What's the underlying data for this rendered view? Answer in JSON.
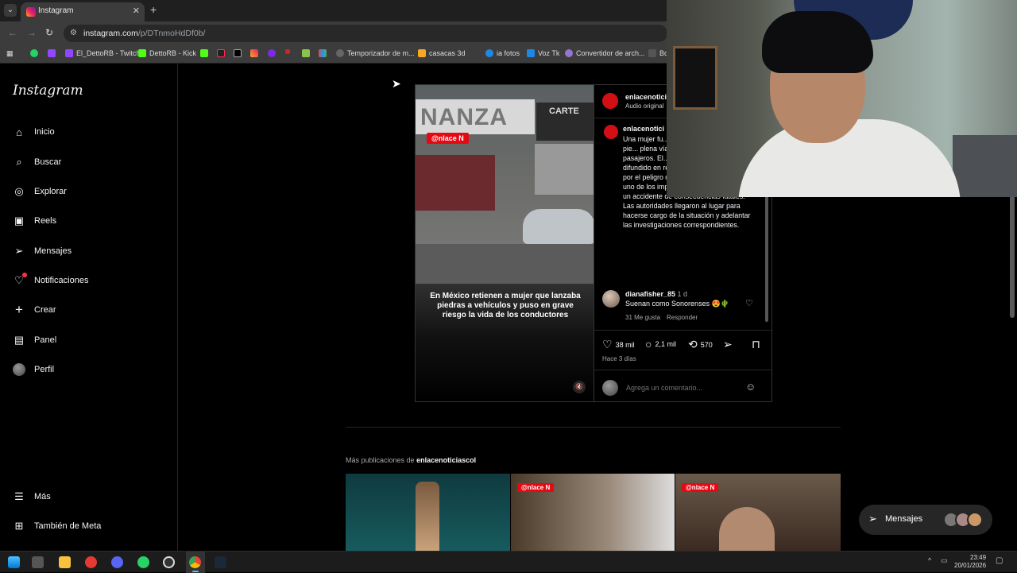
{
  "browser": {
    "tab_title": "Instagram",
    "tab_close": "✕",
    "new_tab": "+",
    "url_host": "instagram.com",
    "url_path": "/p/DTnmoHdDf0b/",
    "bookmarks": [
      "El_DettoRB - Twitch",
      "DettoRB - Kick",
      "Temporizador de m...",
      "casacas 3d",
      "ia fotos",
      "Voz Tk",
      "Convertidor de arch...",
      "Bot"
    ]
  },
  "sidebar": {
    "logo": "Instagram",
    "items": [
      {
        "label": "Inicio",
        "icon": "home-icon"
      },
      {
        "label": "Buscar",
        "icon": "search-icon"
      },
      {
        "label": "Explorar",
        "icon": "compass-icon"
      },
      {
        "label": "Reels",
        "icon": "reels-icon"
      },
      {
        "label": "Mensajes",
        "icon": "send-icon"
      },
      {
        "label": "Notificaciones",
        "icon": "heart-icon"
      },
      {
        "label": "Crear",
        "icon": "plus-icon"
      },
      {
        "label": "Panel",
        "icon": "dashboard-icon"
      },
      {
        "label": "Perfil",
        "icon": "avatar"
      }
    ],
    "bottom": [
      {
        "label": "Más",
        "icon": "menu-icon"
      },
      {
        "label": "También de Meta",
        "icon": "meta-icon"
      }
    ]
  },
  "post": {
    "video_badge": "@nlace N",
    "video_sign": "NANZA",
    "video_billboard": "CARTE",
    "video_caption": "En México retienen a mujer que lanzaba piedras a vehículos y puso en grave riesgo la vida de los conductores",
    "author": "enlacenotici",
    "audio": "Audio original",
    "caption_author": "enlacenotici",
    "caption": "Una mujer fu... en México lu... lanzando pie... plena vía, una... riesgo la vida... pasajeros. El... registrado en video y difundido en redes sociales, generó alarma por el peligro que representaba, ya que uno de los impactos pudo haber provocado un accidente de consecuencias fatales. Las autoridades llegaron al lugar para hacerse cargo de la situación y adelantar las investigaciones correspondientes.",
    "comment": {
      "user": "dianafisher_85",
      "age": "1 d",
      "text": "Suenan como Sonorenses 😍🌵",
      "likes": "31 Me gusta",
      "reply": "Responder"
    },
    "likes": "38 mil",
    "comments": "2,1 mil",
    "reposts": "570",
    "time_ago": "Hace 3 días",
    "comment_placeholder": "Agrega un comentario..."
  },
  "more": {
    "prefix": "Más publicaciones de ",
    "account": "enlacenoticiascol",
    "thumb_badge": "@nlace N"
  },
  "messages_pill": {
    "label": "Mensajes"
  },
  "taskbar": {
    "time": "23:49",
    "date": "20/01/2026"
  },
  "colors": {
    "accent_red": "#e50914",
    "notif": "#ff3040",
    "bg": "#000000"
  }
}
